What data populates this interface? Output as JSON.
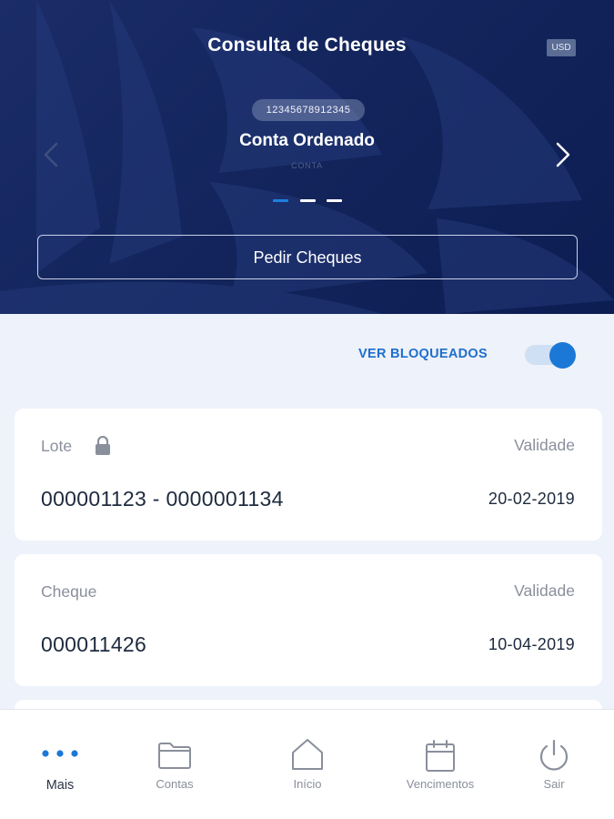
{
  "header": {
    "title": "Consulta de Cheques",
    "currency": "USD",
    "account_number": "12345678912345",
    "account_name": "Conta Ordenado",
    "account_type": "CONTA",
    "carousel": {
      "count": 3,
      "active_index": 0
    },
    "order_button_label": "Pedir Cheques"
  },
  "filter": {
    "show_blocked_label": "VER BLOQUEADOS",
    "show_blocked_on": true
  },
  "cards": [
    {
      "label": "Lote",
      "locked": true,
      "right_label": "Validade",
      "value": "000001123 - 0000001134",
      "date": "20-02-2019"
    },
    {
      "label": "Cheque",
      "locked": false,
      "right_label": "Validade",
      "value": "000011426",
      "date": "10-04-2019"
    }
  ],
  "tabbar": {
    "items": [
      {
        "label": "Mais",
        "icon": "more-dots-icon",
        "active": true
      },
      {
        "label": "Contas",
        "icon": "folder-icon",
        "active": false
      },
      {
        "label": "Início",
        "icon": "home-icon",
        "active": false
      },
      {
        "label": "Vencimentos",
        "icon": "calendar-icon",
        "active": false
      },
      {
        "label": "Sair",
        "icon": "power-icon",
        "active": false
      }
    ]
  },
  "colors": {
    "header_bg": "#13255c",
    "accent_blue": "#1c78d6",
    "dot_active": "#1e7fe0",
    "dot_inactive": "#ffffff",
    "page_bg": "#eef2fa"
  }
}
